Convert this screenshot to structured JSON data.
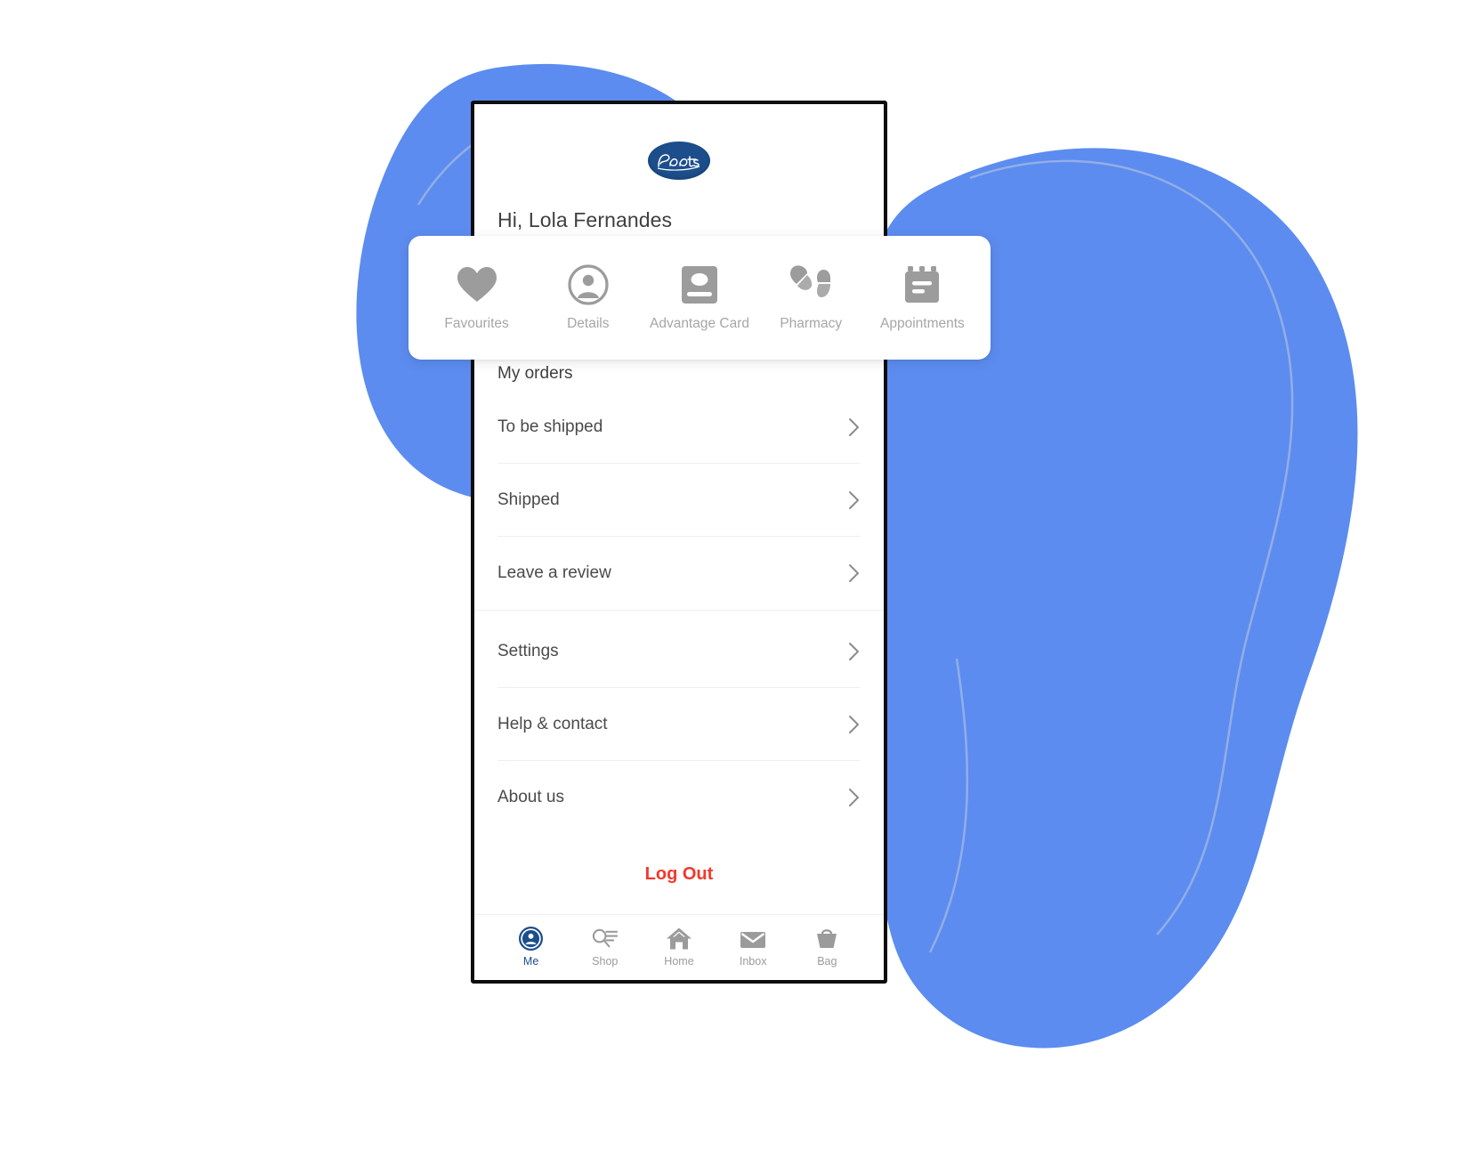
{
  "background": {
    "blob_color": "#5c8cef",
    "blob_outline_color": "#93aee6",
    "page_background": "#ffffff"
  },
  "brand": {
    "logo_name": "boots-logo",
    "logo_text": "Boots",
    "logo_color": "#1c4e8c"
  },
  "header": {
    "greeting": "Hi, Lola Fernandes"
  },
  "quick_access": {
    "items": [
      {
        "label": "Favourites",
        "icon": "heart-icon"
      },
      {
        "label": "Details",
        "icon": "person-circle-icon"
      },
      {
        "label": "Advantage Card",
        "icon": "card-icon"
      },
      {
        "label": "Pharmacy",
        "icon": "pills-icon"
      },
      {
        "label": "Appointments",
        "icon": "calendar-icon"
      }
    ]
  },
  "orders": {
    "section_title": "My orders",
    "rows": [
      {
        "label": "To be shipped"
      },
      {
        "label": "Shipped"
      },
      {
        "label": "Leave a review"
      }
    ]
  },
  "settings_group": {
    "rows": [
      {
        "label": "Settings"
      },
      {
        "label": "Help & contact"
      },
      {
        "label": "About us"
      }
    ]
  },
  "logout": {
    "label": "Log Out",
    "color": "#f0392b"
  },
  "tabbar": {
    "active_color": "#1c4e8c",
    "inactive_color": "#9b9b9b",
    "tabs": [
      {
        "label": "Me",
        "icon": "person-filled-circle-icon",
        "active": true
      },
      {
        "label": "Shop",
        "icon": "search-list-icon",
        "active": false
      },
      {
        "label": "Home",
        "icon": "house-icon",
        "active": false
      },
      {
        "label": "Inbox",
        "icon": "envelope-icon",
        "active": false
      },
      {
        "label": "Bag",
        "icon": "basket-icon",
        "active": false
      }
    ]
  }
}
